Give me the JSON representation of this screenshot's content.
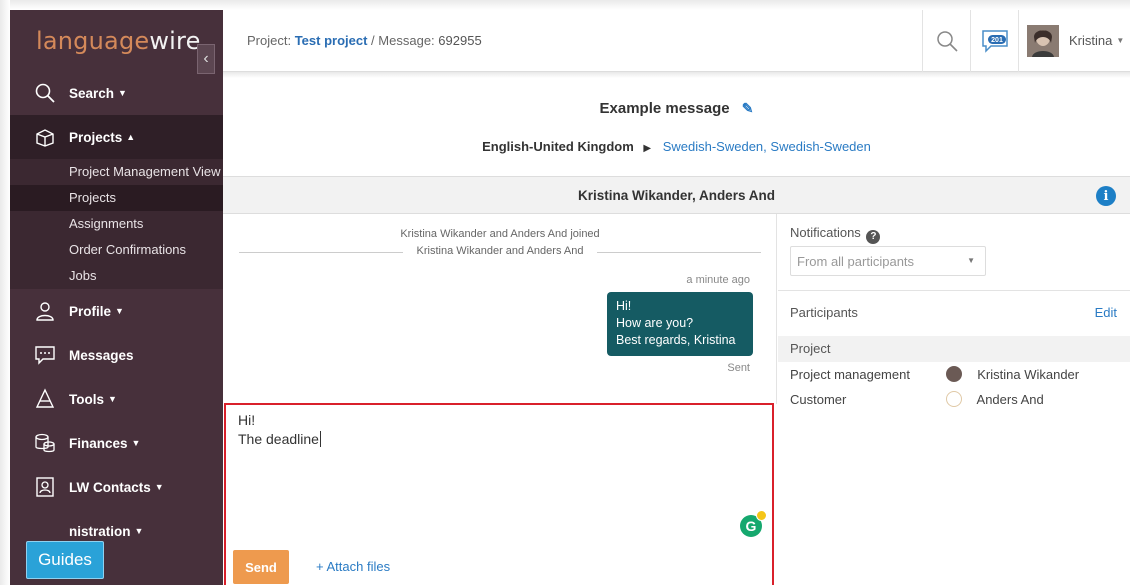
{
  "brand": {
    "part1": "language",
    "part2": "wire"
  },
  "sidebar": {
    "items": [
      {
        "label": "Search",
        "caret": "▼"
      },
      {
        "label": "Projects",
        "caret": "▲"
      },
      {
        "label": "Profile",
        "caret": "▼"
      },
      {
        "label": "Messages",
        "caret": ""
      },
      {
        "label": "Tools",
        "caret": "▼"
      },
      {
        "label": "Finances",
        "caret": "▼"
      },
      {
        "label": "LW Contacts",
        "caret": "▼"
      },
      {
        "label": "nistration",
        "caret": "▼"
      }
    ],
    "sub_items": [
      "Project Management View",
      "Projects",
      "Assignments",
      "Order Confirmations",
      "Jobs"
    ],
    "guides_label": "Guides"
  },
  "header": {
    "crumb_project_prefix": "Project:",
    "crumb_project": "Test project",
    "crumb_sep": "/",
    "crumb_message_prefix": "Message:",
    "crumb_message": "692955",
    "chat_badge": "201",
    "user_name": "Kristina"
  },
  "message": {
    "title": "Example message",
    "source_lang": "English-United Kingdom",
    "target_langs": [
      "Swedish-Sweden",
      "Swedish-Sweden"
    ],
    "target_sep": ",",
    "participants_bar": "Kristina Wikander, Anders And"
  },
  "chat": {
    "system1": "Kristina Wikander and Anders And joined",
    "system2": "Kristina Wikander and Anders And",
    "time": "a minute ago",
    "bubble_lines": [
      "Hi!",
      "How are you?",
      "Best regards, Kristina"
    ],
    "status": "Sent"
  },
  "compose": {
    "lines": [
      "Hi!",
      "The deadline"
    ],
    "send_label": "Send",
    "attach_label": "+ Attach files"
  },
  "panel": {
    "notifications_label": "Notifications",
    "notifications_value": "From all participants",
    "participants_label": "Participants",
    "edit_label": "Edit",
    "section": "Project",
    "rows": [
      {
        "role": "Project management",
        "name": "Kristina Wikander"
      },
      {
        "role": "Customer",
        "name": "Anders And"
      }
    ]
  },
  "colors": {
    "sidebar": "#47303b",
    "accent": "#2a7bc4",
    "send": "#ee9a4e",
    "bubble": "#155b63",
    "highlight": "#d9202b"
  }
}
